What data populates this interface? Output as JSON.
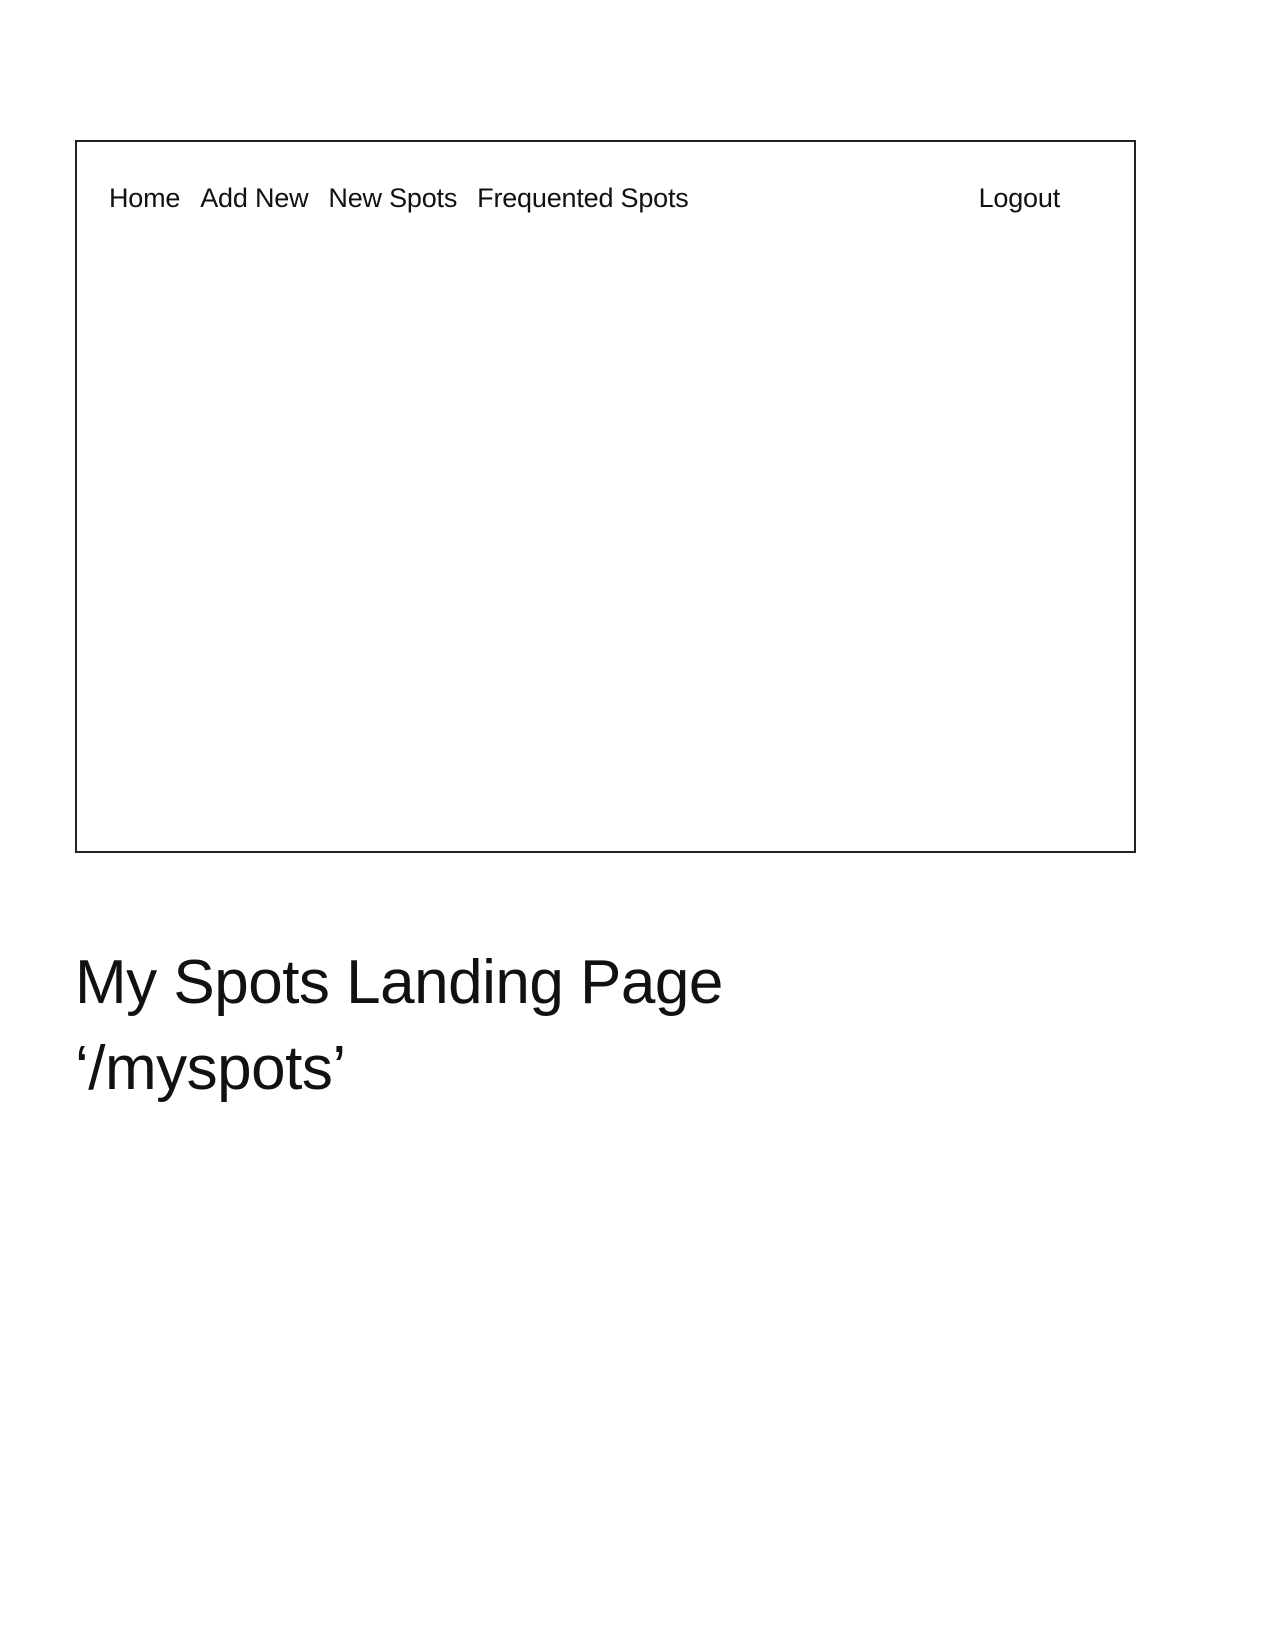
{
  "nav": {
    "items": [
      {
        "label": "Home"
      },
      {
        "label": "Add New"
      },
      {
        "label": "New Spots"
      },
      {
        "label": "Frequented Spots"
      }
    ],
    "logout_label": "Logout"
  },
  "caption": {
    "title": "My Spots Landing Page",
    "route": "‘/myspots’"
  }
}
